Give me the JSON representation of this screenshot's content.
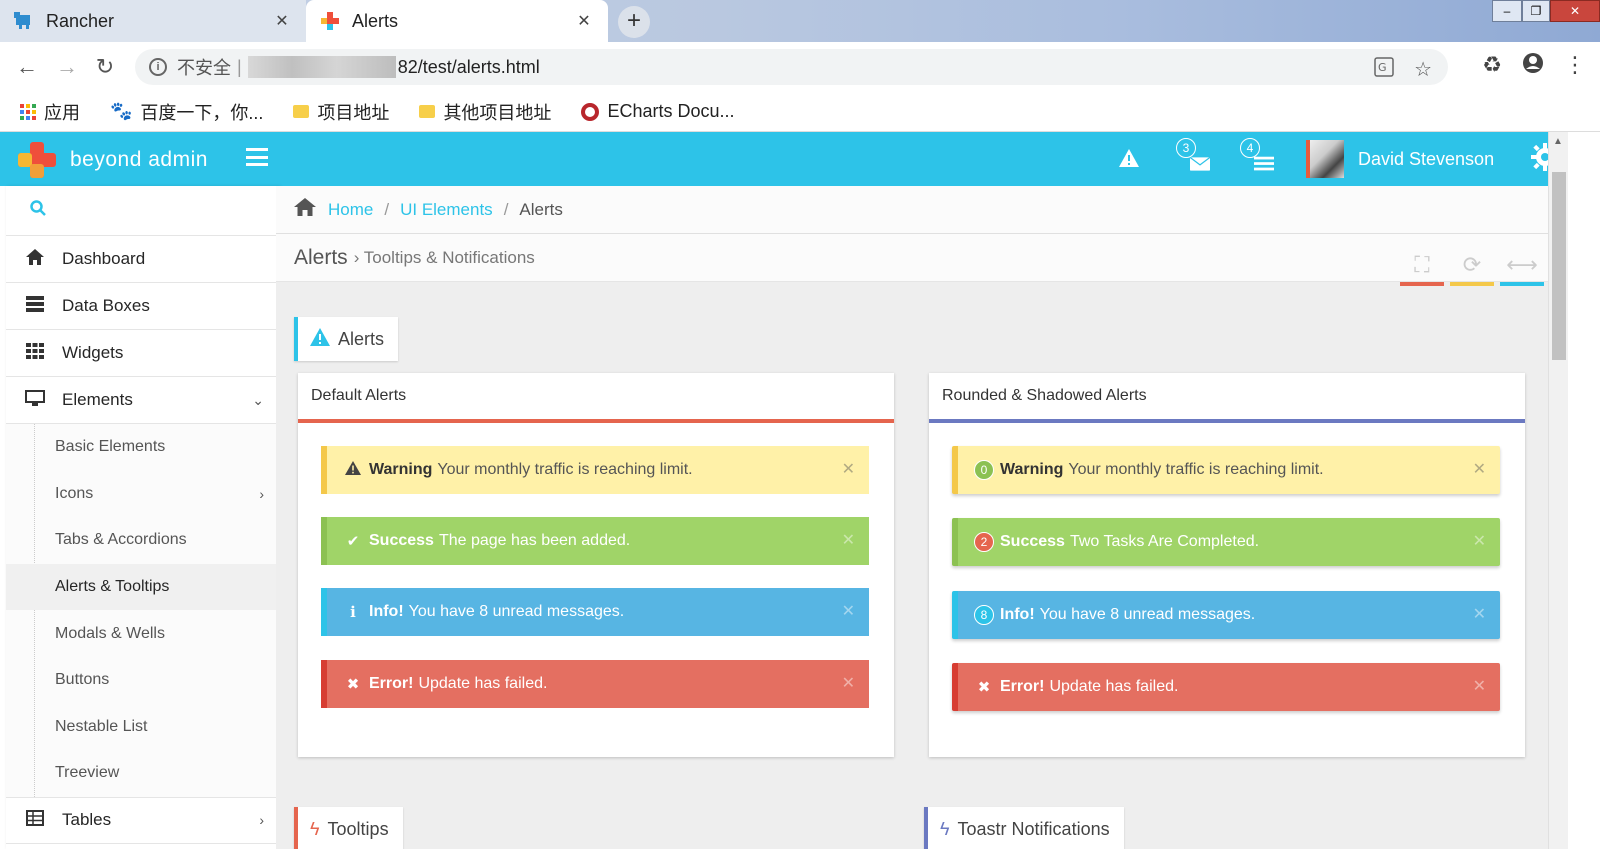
{
  "browser": {
    "tabs": [
      {
        "title": "Rancher",
        "close": "✕"
      },
      {
        "title": "Alerts",
        "close": "✕"
      }
    ],
    "new_tab": "+",
    "window_controls": {
      "min": "–",
      "max": "❐",
      "close": "✕"
    },
    "address": {
      "insecure_label": "不安全",
      "separator": "|",
      "url_suffix": "82/test/alerts.html"
    },
    "bookmarks": [
      {
        "label": "应用"
      },
      {
        "label": "百度一下，你..."
      },
      {
        "label": "项目地址"
      },
      {
        "label": "其他项目地址"
      },
      {
        "label": "ECharts Docu..."
      }
    ]
  },
  "app": {
    "brand": "beyond admin",
    "user_name": "David Stevenson",
    "header_badges": {
      "mail": "3",
      "tasks": "4"
    }
  },
  "sidebar": {
    "items": [
      {
        "label": "Dashboard"
      },
      {
        "label": "Data Boxes"
      },
      {
        "label": "Widgets"
      },
      {
        "label": "Elements"
      }
    ],
    "submenu": [
      {
        "label": "Basic Elements"
      },
      {
        "label": "Icons"
      },
      {
        "label": "Tabs & Accordions"
      },
      {
        "label": "Alerts & Tooltips"
      },
      {
        "label": "Modals & Wells"
      },
      {
        "label": "Buttons"
      },
      {
        "label": "Nestable List"
      },
      {
        "label": "Treeview"
      }
    ],
    "tables": {
      "label": "Tables"
    }
  },
  "breadcrumb": {
    "home": "Home",
    "ui": "UI Elements",
    "current": "Alerts"
  },
  "page": {
    "title": "Alerts",
    "subtitle": "Tooltips & Notifications"
  },
  "sections": {
    "alerts": "Alerts",
    "tooltips": "Tooltips",
    "toastr": "Toastr Notifications"
  },
  "default_alerts": {
    "title": "Default Alerts",
    "items": [
      {
        "strong": "Warning",
        "text": "Your monthly traffic is reaching limit."
      },
      {
        "strong": "Success",
        "text": "The page has been added."
      },
      {
        "strong": "Info!",
        "text": "You have 8 unread messages."
      },
      {
        "strong": "Error!",
        "text": "Update has failed."
      }
    ]
  },
  "rounded_alerts": {
    "title": "Rounded & Shadowed Alerts",
    "items": [
      {
        "badge": "0",
        "strong": "Warning",
        "text": "Your monthly traffic is reaching limit."
      },
      {
        "badge": "2",
        "strong": "Success",
        "text": "Two Tasks Are Completed."
      },
      {
        "badge": "8",
        "strong": "Info!",
        "text": "You have 8 unread messages."
      },
      {
        "strong": "Error!",
        "text": "Update has failed."
      }
    ]
  },
  "colors": {
    "accent": "#2dc3e8",
    "warning": "#fff1a8",
    "success": "#a0d468",
    "info": "#57b5e3",
    "danger": "#e46f61"
  }
}
